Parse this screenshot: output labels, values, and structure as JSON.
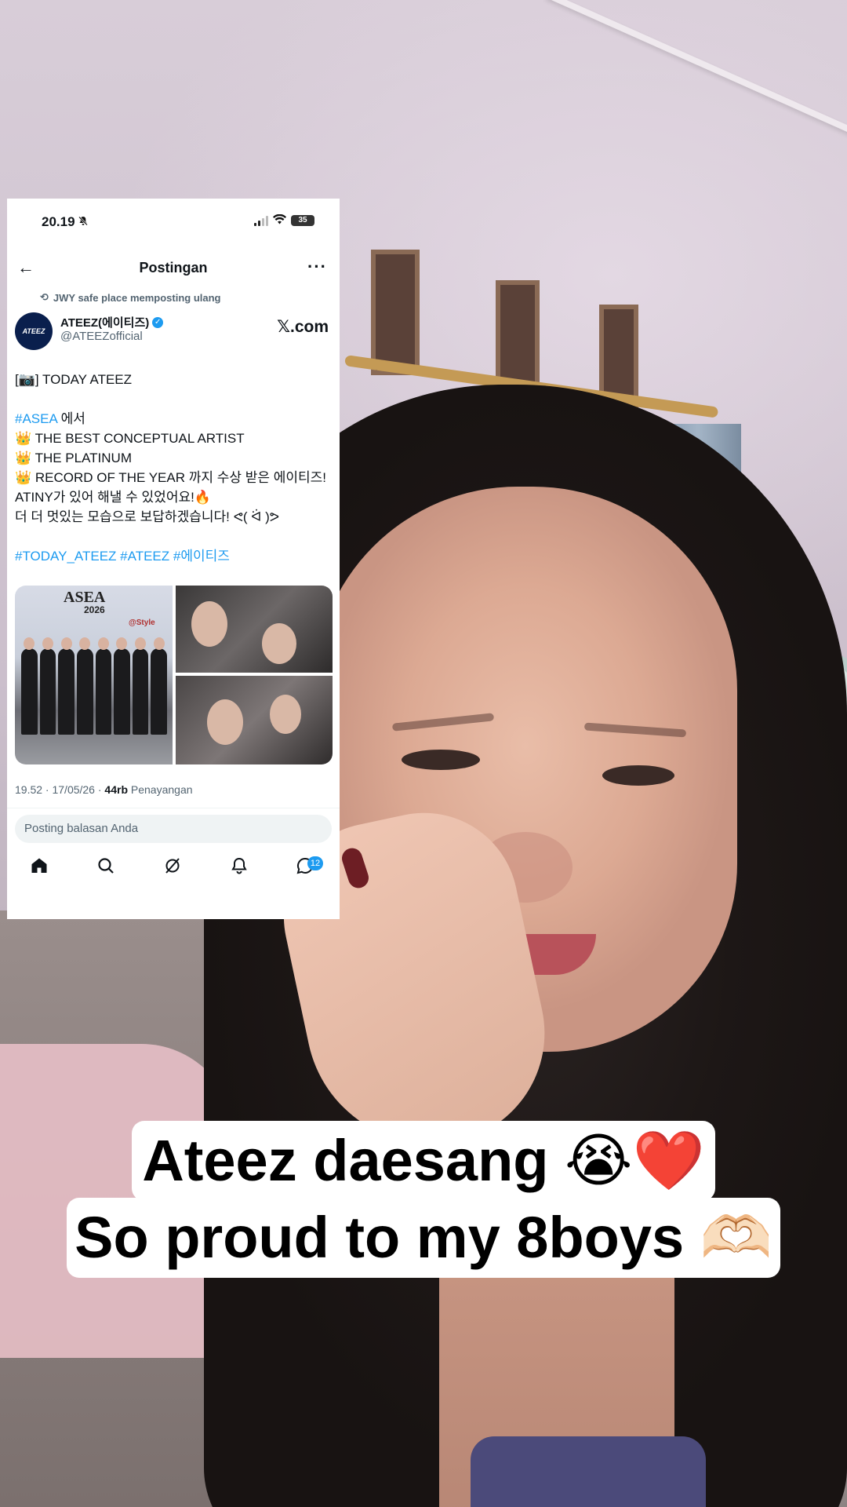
{
  "status_bar": {
    "time": "20.19",
    "mute_icon": "bell-slash-icon",
    "battery": "35"
  },
  "nav": {
    "back_icon": "arrow-left-icon",
    "title": "Postingan",
    "more_icon": "more-icon"
  },
  "repost": {
    "icon": "repost-icon",
    "text": "JWY safe place memposting ulang"
  },
  "author": {
    "name": "ATEEZ(에이티즈)",
    "handle": "@ATEEZofficial",
    "avatar_text": "ATEEZ",
    "source_badge": "𝕏.com"
  },
  "tweet": {
    "line1": "[📷] TODAY ATEEZ",
    "line2_tag": "#ASEA",
    "line2_rest": " 에서",
    "line3": "👑 THE BEST CONCEPTUAL ARTIST",
    "line4": "👑 THE PLATINUM",
    "line5": "👑 RECORD OF THE YEAR 까지 수상 받은 에이티즈!",
    "line6": "ATINY가 있어 해낼 수 있었어요!🔥",
    "line7": "더 더 멋있는 모습으로 보답하겠습니다! ᕙ( ᐛ )ᕗ",
    "hashtag1": "#TODAY_ATEEZ",
    "hashtag2": "#ATEEZ",
    "hashtag3": "#에이티즈"
  },
  "media": {
    "backdrop_title": "ASEA",
    "backdrop_year": "2026",
    "backdrop_sponsor": "@Style"
  },
  "meta": {
    "timestamp": "19.52 · 17/05/26 · ",
    "views_count": "44rb",
    "views_label": " Penayangan"
  },
  "reply": {
    "placeholder": "Posting balasan Anda"
  },
  "tab_bar": {
    "messages_badge": "12"
  },
  "caption": {
    "line1": "Ateez daesang 😭❤️",
    "line2": "So proud to my 8boys 🫶🏻"
  },
  "colors": {
    "link": "#1d9bf0",
    "caption_bg": "#ffffff"
  }
}
